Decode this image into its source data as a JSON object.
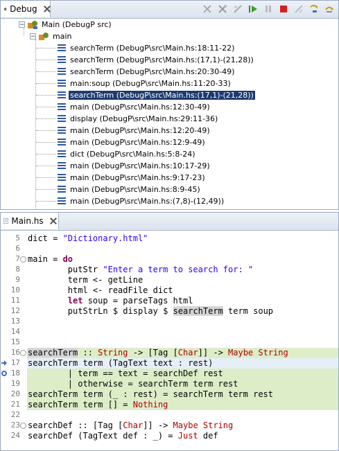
{
  "debug": {
    "tab_label": "Debug",
    "root": "Main (DebugP src)",
    "thread": "main",
    "frames": [
      "searchTerm (DebugP\\src\\Main.hs:18:11-22)",
      "searchTerm (DebugP\\src\\Main.hs:(17,1)-(21,28))",
      "searchTerm (DebugP\\src\\Main.hs:20:30-49)",
      "main:soup (DebugP\\src\\Main.hs:11:20-33)",
      "searchTerm (DebugP\\src\\Main.hs:(17,1)-(21,28))",
      "main (DebugP\\src\\Main.hs:12:30-49)",
      "display (DebugP\\src\\Main.hs:29:11-36)",
      "main (DebugP\\src\\Main.hs:12:20-49)",
      "main (DebugP\\src\\Main.hs:12:9-49)",
      "dict (DebugP\\src\\Main.hs:5:8-24)",
      "main (DebugP\\src\\Main.hs:10:17-29)",
      "main (DebugP\\src\\Main.hs:9:17-23)",
      "main (DebugP\\src\\Main.hs:8:9-45)",
      "main (DebugP\\src\\Main.hs:(7,8)-(12,49))"
    ],
    "selected_frame_index": 4,
    "toolbar_icons": [
      "remove-terminated-icon",
      "remove-all-terminated-icon",
      "connect-icon",
      "resume-icon",
      "suspend-icon",
      "terminate-icon",
      "disconnect-icon",
      "step-into-icon",
      "step-over-icon"
    ]
  },
  "editor": {
    "tab_label": "Main.hs",
    "lines": [
      {
        "n": "5",
        "tokens": [
          [
            "t",
            "dict = "
          ],
          [
            "s",
            "\"Dictionary.html\""
          ]
        ]
      },
      {
        "n": "6",
        "tokens": []
      },
      {
        "n": "7",
        "fold": true,
        "tokens": [
          [
            "t",
            "main = "
          ],
          [
            "k",
            "do"
          ]
        ]
      },
      {
        "n": "8",
        "tokens": [
          [
            "t",
            "        putStr "
          ],
          [
            "s",
            "\"Enter a term to search for: \""
          ]
        ]
      },
      {
        "n": "9",
        "tokens": [
          [
            "t",
            "        term <- getLine"
          ]
        ]
      },
      {
        "n": "10",
        "tokens": [
          [
            "t",
            "        html <- readFile dict"
          ]
        ]
      },
      {
        "n": "11",
        "tokens": [
          [
            "t",
            "        "
          ],
          [
            "k",
            "let"
          ],
          [
            "t",
            " soup = parseTags html"
          ]
        ]
      },
      {
        "n": "12",
        "tokens": [
          [
            "t",
            "        putStrLn $ display $ "
          ],
          [
            "o",
            "searchTerm"
          ],
          [
            "t",
            " term soup"
          ]
        ]
      },
      {
        "n": "13",
        "tokens": []
      },
      {
        "n": "14",
        "tokens": []
      },
      {
        "n": "15",
        "tokens": []
      },
      {
        "n": "16",
        "fold": true,
        "hl": "green",
        "tokens": [
          [
            "o",
            "searchTerm"
          ],
          [
            "t",
            " :: "
          ],
          [
            "y",
            "String"
          ],
          [
            "t",
            " -> [Tag ["
          ],
          [
            "y",
            "Char"
          ],
          [
            "t",
            "]] -> "
          ],
          [
            "y",
            "Maybe String"
          ]
        ]
      },
      {
        "n": "17",
        "hl": "current",
        "marker": "arrow",
        "tokens": [
          [
            "t",
            "searchTerm term (TagText text : rest)"
          ]
        ]
      },
      {
        "n": "18",
        "hl": "green",
        "marker": "bp",
        "tokens": [
          [
            "t",
            "        | term == text = searchDef rest"
          ]
        ]
      },
      {
        "n": "19",
        "hl": "green",
        "tokens": [
          [
            "t",
            "        | otherwise = searchTerm term rest"
          ]
        ]
      },
      {
        "n": "20",
        "hl": "green",
        "tokens": [
          [
            "t",
            "searchTerm term (_ : rest) = searchTerm term rest"
          ]
        ]
      },
      {
        "n": "21",
        "hl": "green",
        "tokens": [
          [
            "t",
            "searchTerm term [] = "
          ],
          [
            "y",
            "Nothing"
          ]
        ]
      },
      {
        "n": "22",
        "tokens": []
      },
      {
        "n": "23",
        "fold": true,
        "tokens": [
          [
            "t",
            "searchDef :: [Tag ["
          ],
          [
            "y",
            "Char"
          ],
          [
            "t",
            "]] -> "
          ],
          [
            "y",
            "Maybe String"
          ]
        ]
      },
      {
        "n": "24",
        "tokens": [
          [
            "t",
            "searchDef (TagText def : _) = "
          ],
          [
            "y",
            "Just"
          ],
          [
            "t",
            " def"
          ]
        ]
      }
    ]
  },
  "colors": {
    "selection": "#1d3b6e",
    "green_highlight": "#dcedc8",
    "keyword": "#7f0055",
    "type": "#b00000",
    "string": "#2a00ff"
  }
}
